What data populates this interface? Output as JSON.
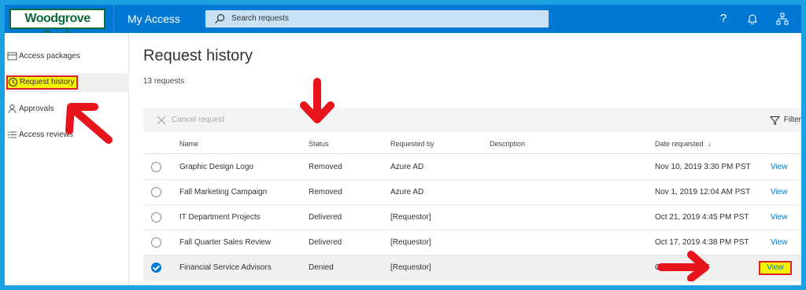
{
  "header": {
    "logo": "Woodgrove Bank",
    "app_title": "My Access",
    "search_placeholder": "Search requests"
  },
  "sidebar": {
    "items": [
      {
        "label": "Access packages",
        "icon": "package-icon"
      },
      {
        "label": "Request history",
        "icon": "history-icon"
      },
      {
        "label": "Approvals",
        "icon": "person-icon"
      },
      {
        "label": "Access reviews",
        "icon": "list-icon"
      }
    ]
  },
  "main": {
    "title": "Request history",
    "count": "13 requests",
    "toolbar": {
      "cancel": "Cancel request",
      "filter": "Filter"
    },
    "columns": {
      "name": "Name",
      "status": "Status",
      "requested_by": "Requested by",
      "description": "Description",
      "date": "Date requested"
    },
    "rows": [
      {
        "name": "Graphic Design Logo",
        "status": "Removed",
        "requested_by": "Azure AD",
        "description": "",
        "date": "Nov 10, 2019 3:30 PM PST",
        "action": "View"
      },
      {
        "name": "Fall Marketing Campaign",
        "status": "Removed",
        "requested_by": "Azure AD",
        "description": "",
        "date": "Nov 1, 2019 12:04 AM PST",
        "action": "View"
      },
      {
        "name": "IT Department Projects",
        "status": "Delivered",
        "requested_by": "[Requestor]",
        "description": "",
        "date": "Oct 21, 2019 4:45 PM PST",
        "action": "View"
      },
      {
        "name": "Fall Quarter Sales Review",
        "status": "Delivered",
        "requested_by": "[Requestor]",
        "description": "",
        "date": "Oct 17, 2019 4:38 PM PST",
        "action": "View"
      },
      {
        "name": "Financial Service Advisors",
        "status": "Denied",
        "requested_by": "[Requestor]",
        "description": "",
        "date": "Oct 31 PM PST",
        "action": "View",
        "selected": true
      }
    ]
  },
  "colors": {
    "frame": "#1ba1e2",
    "topbar": "#0078d4",
    "highlight": "#f4f200",
    "annotation_red": "#d9252a",
    "link": "#0078d4"
  }
}
